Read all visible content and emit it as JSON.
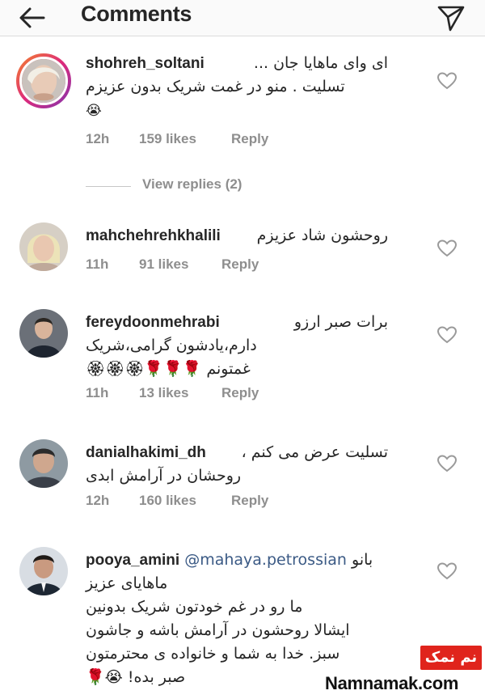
{
  "header": {
    "title": "Comments",
    "back_icon": "arrow-left-icon",
    "send_icon": "paper-plane-icon"
  },
  "comments": [
    {
      "username": "shohreh_soltani",
      "lines": [
        "ای وای ماهایا جان ...",
        "تسلیت . منو در غمت شریک بدون عزیزم",
        "😭"
      ],
      "time": "12h",
      "likes": "159 likes",
      "reply": "Reply"
    },
    {
      "username": "mahchehrehkhalili",
      "lines": [
        "روحشون شاد عزیزم"
      ],
      "time": "11h",
      "likes": "91 likes",
      "reply": "Reply"
    },
    {
      "username": "fereydoonmehrabi",
      "lines": [
        "برات صبر ارزو",
        "دارم،یادشون گرامی،شریک",
        "غمتونم 🌹🌹🌹🏵🏵🏵"
      ],
      "time": "11h",
      "likes": "13 likes",
      "reply": "Reply"
    },
    {
      "username": "danialhakimi_dh",
      "lines": [
        "تسلیت عرض می کنم ،",
        "روحشان در آرامش ابدی"
      ],
      "time": "12h",
      "likes": "160 likes",
      "reply": "Reply"
    },
    {
      "username": "pooya_amini",
      "mention": "@mahaya.petrossian",
      "lines": [
        "بانو",
        "ماهایای عزیز",
        "ما رو در غم خودتون شریک بدونین",
        "ایشالا روحشون در آرامش باشه و جاشون",
        "سبز. خدا به شما و خانواده ی محترمتون",
        "صبر بده! 😭🌹"
      ]
    }
  ],
  "view_replies": "View replies (2)",
  "watermark": {
    "badge": "نم نمک",
    "site": "Namnamak.com"
  },
  "colors": {
    "text": "#262626",
    "meta": "#8e8e8e",
    "mention": "#3b5a85",
    "badge": "#e0241c"
  }
}
